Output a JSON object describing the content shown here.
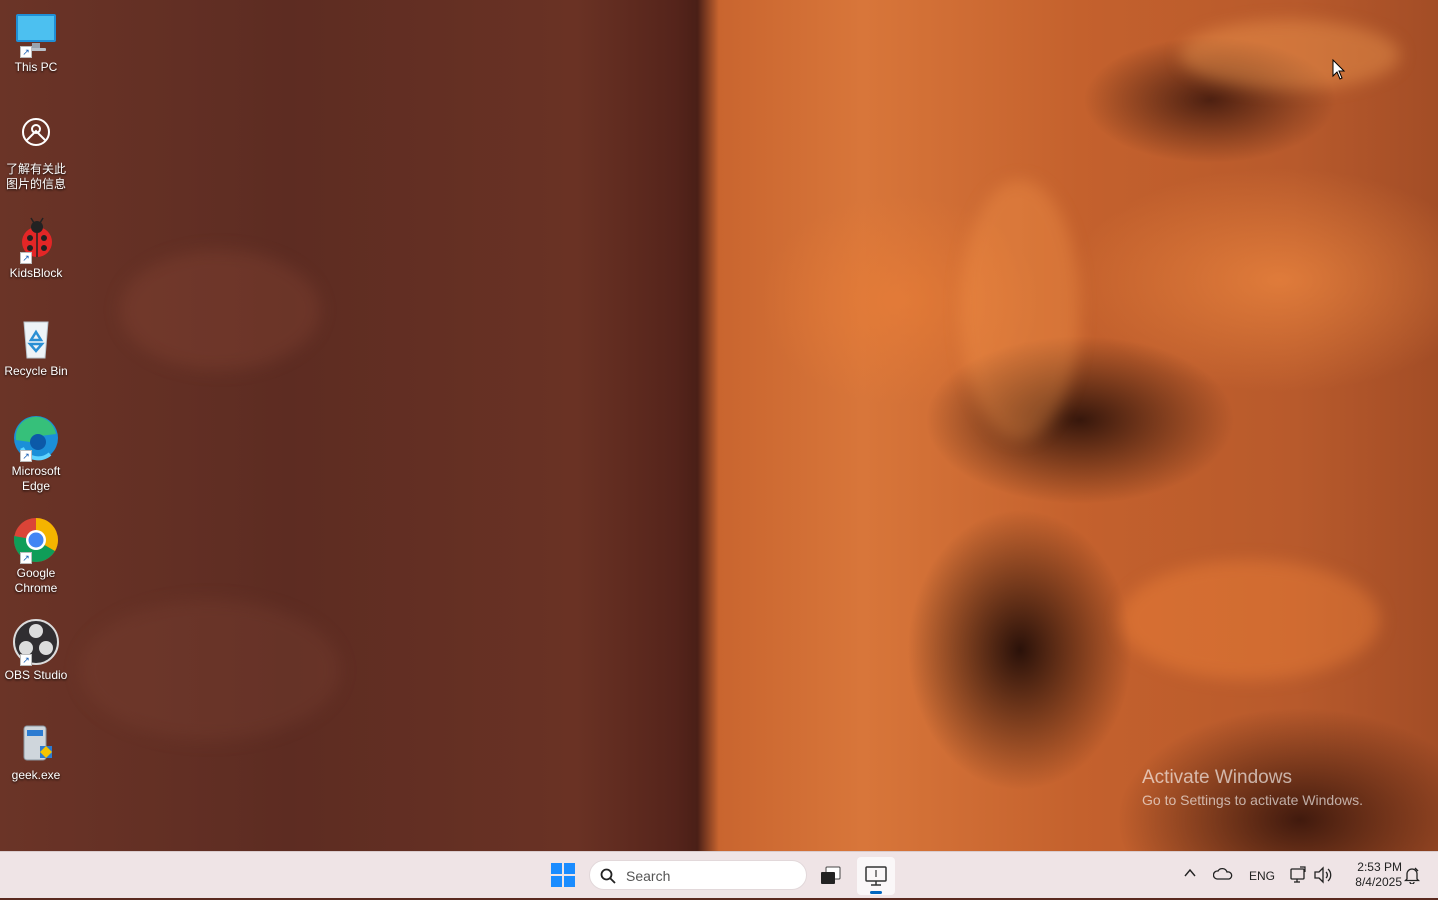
{
  "desktop": {
    "icons": [
      {
        "label": "This PC",
        "icon": "monitor-icon"
      },
      {
        "label": "了解有关此图片的信息",
        "icon": "info-camera-icon"
      },
      {
        "label": "KidsBlock",
        "icon": "ladybug-icon"
      },
      {
        "label": "Recycle Bin",
        "icon": "recycle-bin-icon"
      },
      {
        "label": "Microsoft Edge",
        "icon": "edge-icon"
      },
      {
        "label": "Google Chrome",
        "icon": "chrome-icon"
      },
      {
        "label": "OBS Studio",
        "icon": "obs-icon"
      },
      {
        "label": "geek.exe",
        "icon": "geek-uninstaller-icon"
      }
    ]
  },
  "watermark": {
    "title": "Activate Windows",
    "subtitle": "Go to Settings to activate Windows."
  },
  "taskbar": {
    "search_placeholder": "Search",
    "tray": {
      "language": "ENG"
    },
    "clock": {
      "time": "2:53 PM",
      "date": "8/4/2025"
    }
  },
  "colors": {
    "taskbar_bg": "#efe4e6",
    "accent": "#0067c0"
  }
}
